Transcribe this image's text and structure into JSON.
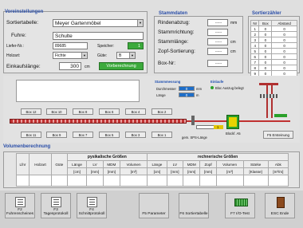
{
  "vorein": {
    "title": "Voreinstellungen",
    "sortiertabelle": {
      "label": "Sortiertabelle:",
      "value": "Meyer Gartenmöbel"
    },
    "fuhre": {
      "label": "Fuhre:",
      "value": "Schulte"
    },
    "liefer": {
      "label": "Liefer-Nr.:",
      "value": "89685"
    },
    "speicher": {
      "label": "Speicher:",
      "value": "1"
    },
    "holzart": {
      "label": "Holzart:",
      "value": "Fichte"
    },
    "guete": {
      "label": "Güte:",
      "value": "B"
    },
    "einkauf": {
      "label": "Einkaufslänge:",
      "value": "300",
      "unit": "cm"
    },
    "vorber": "Vorberechnung"
  },
  "stamm": {
    "title": "Stammdaten",
    "rinde": {
      "label": "Rindenabzug:",
      "value": "------",
      "unit": "mm"
    },
    "richtung": {
      "label": "Stammrichtung:",
      "value": "------"
    },
    "laenge": {
      "label": "Stammlänge:",
      "value": "------",
      "unit": "cm"
    },
    "zopf": {
      "label": "Zopf-Sortierung:",
      "value": "------",
      "unit": "cm"
    },
    "box": {
      "label": "Box-Nr:",
      "value": "------"
    }
  },
  "sortz": {
    "title": "Sortierzähler",
    "headers": [
      "Nr",
      "Box",
      "Abstand"
    ],
    "rows": [
      [
        "1",
        "0",
        "0"
      ],
      [
        "2",
        "0",
        "0"
      ],
      [
        "3",
        "0",
        "0"
      ],
      [
        "4",
        "0",
        "0"
      ],
      [
        "5",
        "0",
        "0"
      ],
      [
        "6",
        "0",
        "0"
      ],
      [
        "7",
        "0",
        "0"
      ],
      [
        "8",
        "0",
        "0"
      ],
      [
        "9",
        "0",
        "0"
      ]
    ]
  },
  "line": {
    "stamm": {
      "title": "Stammmessung",
      "d_label": "Durchmesser",
      "d_val": "0",
      "d_unit": "mm",
      "l_label": "Länge",
      "l_val": "0",
      "l_unit": "m"
    },
    "einl": {
      "title": "Einlaufe",
      "status": "Bloc Auszug belegt"
    },
    "top": [
      "Box 12",
      "Box 10",
      "Box 8",
      "Box 6",
      "Box 4",
      "Box 2"
    ],
    "bottom": [
      "Box 11",
      "Box 9",
      "Box 7",
      "Box 5",
      "Box 3",
      "Box 1"
    ],
    "gm": "gem. SPS-Länge",
    "ruler": "1",
    "block": "Blockf. A5",
    "f5": "F5 Ersteinung"
  },
  "vol": {
    "title": "Volumenberechnung",
    "groups": [
      "pysikalische Größen",
      "rechnerische Größen"
    ],
    "cols": [
      "Lfnr",
      "Holzart",
      "Güte",
      "Länge",
      "LV",
      "MDM",
      "Volumen",
      "Länge",
      "LV",
      "MDM",
      "Zopf",
      "Volumen",
      "Stärke",
      "Abk"
    ],
    "units": [
      "[cm]",
      "[mm]",
      "[mm]",
      "[m³]",
      "[cm]",
      "[mm]",
      "[mm]",
      "[mm]",
      "[m³]",
      "[Klasse]",
      "[m³/m]"
    ]
  },
  "fkeys": [
    {
      "label": "F2 Fuhrenscheines"
    },
    {
      "label": "F3 Tagesprotokoll"
    },
    {
      "label": "F4 Schnittprotokoll"
    },
    {
      "label": "F5 Parameter"
    },
    {
      "label": "F6 Sortiertabelle"
    },
    {
      "label": "F7 I/O-Test"
    },
    {
      "label": "ESC Ende"
    }
  ],
  "colors": {
    "title_blue": "#2a4ea8",
    "button_green": "#3caa3c",
    "conveyor_red": "#c03030"
  }
}
